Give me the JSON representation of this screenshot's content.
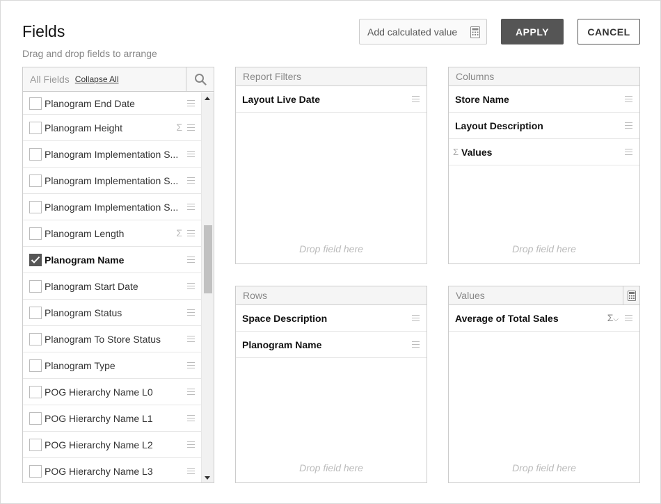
{
  "header": {
    "title": "Fields",
    "subtitle": "Drag and drop fields to arrange",
    "calc_label": "Add calculated value",
    "apply_label": "APPLY",
    "cancel_label": "CANCEL"
  },
  "all_fields": {
    "label": "All Fields",
    "collapse_label": "Collapse All",
    "items": [
      {
        "label": "Planogram End Date",
        "checked": false,
        "sigma": false
      },
      {
        "label": "Planogram Height",
        "checked": false,
        "sigma": true
      },
      {
        "label": "Planogram Implementation S...",
        "checked": false,
        "sigma": false
      },
      {
        "label": "Planogram Implementation S...",
        "checked": false,
        "sigma": false
      },
      {
        "label": "Planogram Implementation S...",
        "checked": false,
        "sigma": false
      },
      {
        "label": "Planogram Length",
        "checked": false,
        "sigma": true
      },
      {
        "label": "Planogram Name",
        "checked": true,
        "sigma": false
      },
      {
        "label": "Planogram Start Date",
        "checked": false,
        "sigma": false
      },
      {
        "label": "Planogram Status",
        "checked": false,
        "sigma": false
      },
      {
        "label": "Planogram To Store Status",
        "checked": false,
        "sigma": false
      },
      {
        "label": "Planogram Type",
        "checked": false,
        "sigma": false
      },
      {
        "label": "POG Hierarchy Name L0",
        "checked": false,
        "sigma": false
      },
      {
        "label": "POG Hierarchy Name L1",
        "checked": false,
        "sigma": false
      },
      {
        "label": "POG Hierarchy Name L2",
        "checked": false,
        "sigma": false
      },
      {
        "label": "POG Hierarchy Name L3",
        "checked": false,
        "sigma": false
      }
    ]
  },
  "report_filters": {
    "label": "Report Filters",
    "items": [
      "Layout Live Date"
    ],
    "drop_label": "Drop field here"
  },
  "columns": {
    "label": "Columns",
    "items": [
      "Store Name",
      "Layout Description",
      "Values"
    ],
    "drop_label": "Drop field here"
  },
  "rows": {
    "label": "Rows",
    "items": [
      "Space Description",
      "Planogram Name"
    ],
    "drop_label": "Drop field here"
  },
  "values": {
    "label": "Values",
    "items": [
      "Average of Total Sales"
    ],
    "drop_label": "Drop field here"
  },
  "icons": {
    "calc": "calculator-icon",
    "search": "search-icon",
    "drag": "drag-handle-icon",
    "sigma": "sigma-icon"
  }
}
